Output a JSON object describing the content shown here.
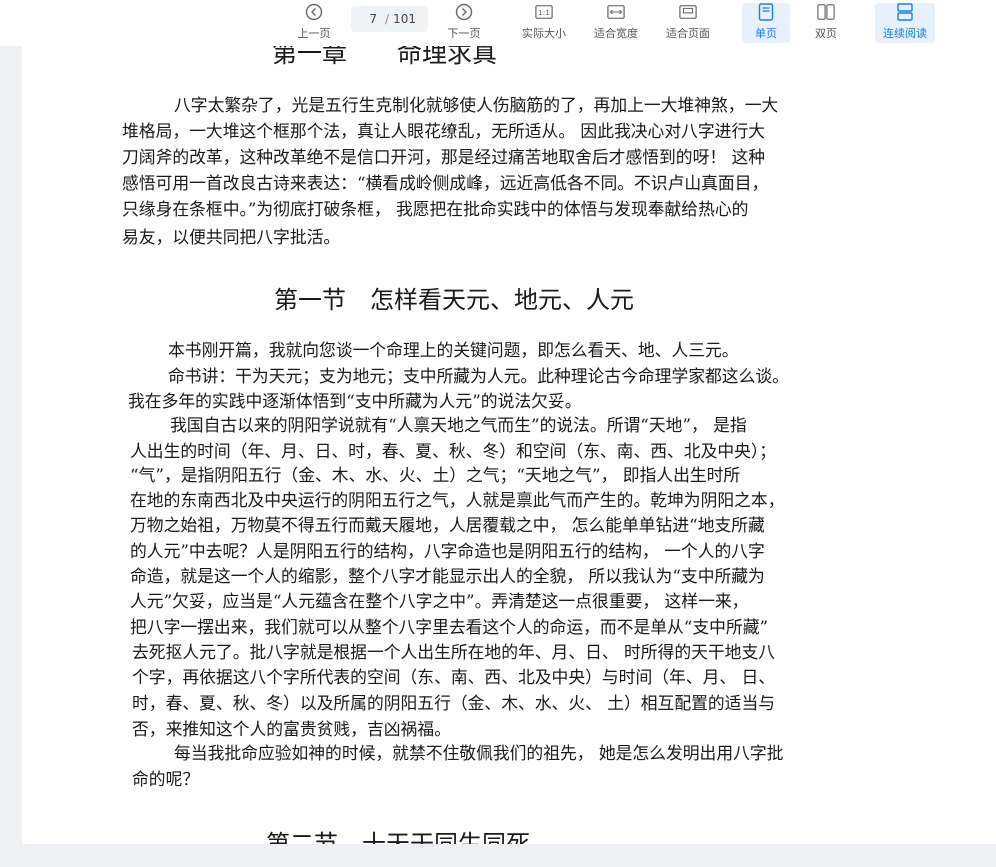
{
  "toolbar": {
    "prev_label": "上一页",
    "next_label": "下一页",
    "current_page": "7",
    "page_separator": "/",
    "total_pages": "101",
    "actual_size_label": "实际大小",
    "fit_width_label": "适合宽度",
    "fit_page_label": "适合页面",
    "single_page_label": "单页",
    "double_page_label": "双页",
    "continuous_label": "连续阅读",
    "actual_size_icon_text": "1:1",
    "accent_color": "#1b7fe0",
    "active_bg": "#e6f1fc"
  },
  "document": {
    "chapter_heading": "第一章　　命理求真",
    "intro_lines": [
      "八字太繁杂了，光是五行生克制化就够使人伤脑筋的了，再加上一大堆神煞，一大",
      "堆格局，一大堆这个框那个法，真让人眼花缭乱，无所适从。 因此我决心对八字进行大",
      "刀阔斧的改革，这种改革绝不是信口开河，那是经过痛苦地取舍后才感悟到的呀！ 这种",
      "感悟可用一首改良古诗来表达：“横看成岭侧成峰，远近高低各不同。不识卢山真面目，",
      "只缘身在条框中。”为彻底打破条框， 我愿把在批命实践中的体悟与发现奉献给热心的",
      "易友，以便共同把八字批活。"
    ],
    "section1_heading": "第一节　怎样看天元、地元、人元",
    "section1_lines": [
      "本书刚开篇，我就向您谈一个命理上的关键问题，即怎么看天、地、人三元。",
      "命书讲：干为天元；支为地元；支中所藏为人元。此种理论古今命理学家都这么谈。",
      "我在多年的实践中逐渐体悟到“支中所藏为人元”的说法欠妥。",
      "我国自古以来的阴阳学说就有“人禀天地之气而生”的说法。所谓“天地”， 是指",
      "人出生的时间（年、月、日、时，春、夏、秋、冬）和空间（东、南、西、北及中央）；",
      "“气”，是指阴阳五行（金、木、水、火、土）之气；“天地之气”， 即指人出生时所",
      "在地的东南西北及中央运行的阴阳五行之气，人就是禀此气而产生的。乾坤为阴阳之本，",
      "万物之始祖，万物莫不得五行而戴天履地，人居覆载之中， 怎么能单单钻进“地支所藏",
      "的人元”中去呢？人是阴阳五行的结构，八字命造也是阴阳五行的结构， 一个人的八字",
      "命造，就是这一个人的缩影，整个八字才能显示出人的全貌， 所以我认为“支中所藏为",
      "人元”欠妥，应当是“人元蕴含在整个八字之中”。弄清楚这一点很重要， 这样一来，",
      "把八字一摆出来，我们就可以从整个八字里去看这个人的命运，而不是单从“支中所藏”",
      "去死抠人元了。批八字就是根据一个人出生所在地的年、月、日、 时所得的天干地支八",
      "个字，再依据这八个字所代表的空间（东、南、西、北及中央）与时间（年、月、 日、",
      "时，春、夏、秋、冬）以及所属的阴阳五行（金、木、水、火、 土）相互配置的适当与",
      "否，来推知这个人的富贵贫贱，吉凶祸福。",
      "每当我批命应验如神的时候，就禁不住敬佩我们的祖先， 她是怎么发明出用八字批",
      "命的呢？"
    ],
    "section2_heading": "第二节　十天干同生同死"
  }
}
